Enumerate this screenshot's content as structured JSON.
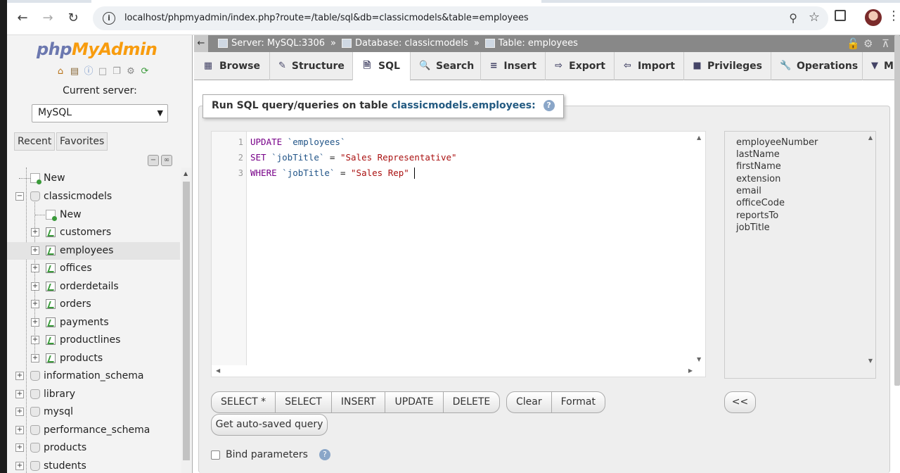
{
  "browser": {
    "url": "localhost/phpmyadmin/index.php?route=/table/sql&db=classicmodels&table=employees"
  },
  "nav": {
    "logo_php": "php",
    "logo_myadmin": "MyAdmin",
    "current_server_label": "Current server:",
    "server_selected": "MySQL",
    "recent_label": "Recent",
    "favorites_label": "Favorites",
    "tree": {
      "new_root": "New",
      "classicmodels": "classicmodels",
      "new_db": "New",
      "tables": [
        "customers",
        "employees",
        "offices",
        "orderdetails",
        "orders",
        "payments",
        "productlines",
        "products"
      ],
      "databases": [
        "information_schema",
        "library",
        "mysql",
        "performance_schema",
        "products",
        "students"
      ]
    }
  },
  "breadcrumb": {
    "server": "Server: MySQL:3306",
    "database": "Database: classicmodels",
    "table": "Table: employees",
    "sep": "»"
  },
  "tabs": {
    "browse": "Browse",
    "structure": "Structure",
    "sql": "SQL",
    "search": "Search",
    "insert": "Insert",
    "export": "Export",
    "import": "Import",
    "privileges": "Privileges",
    "operations": "Operations",
    "more": "M"
  },
  "sql_panel": {
    "legend_prefix": "Run SQL query/queries on table",
    "legend_table": "classicmodels.employees:",
    "code_lines": [
      {
        "num": "1",
        "kw": "UPDATE",
        "rest": "`employees`"
      },
      {
        "num": "2",
        "kw": "SET",
        "col": "`jobTitle`",
        "op": "=",
        "str": "\"Sales Representative\""
      },
      {
        "num": "3",
        "kw": "WHERE",
        "col": "`jobTitle`",
        "op": "=",
        "str": "\"Sales Rep\""
      }
    ],
    "columns": [
      "employeeNumber",
      "lastName",
      "firstName",
      "extension",
      "email",
      "officeCode",
      "reportsTo",
      "jobTitle"
    ],
    "buttons": {
      "select_all": "SELECT *",
      "select": "SELECT",
      "insert": "INSERT",
      "update": "UPDATE",
      "delete": "DELETE",
      "clear": "Clear",
      "format": "Format",
      "insert_col": "<<",
      "get_autosaved": "Get auto-saved query"
    },
    "bind_parameters": "Bind parameters"
  }
}
